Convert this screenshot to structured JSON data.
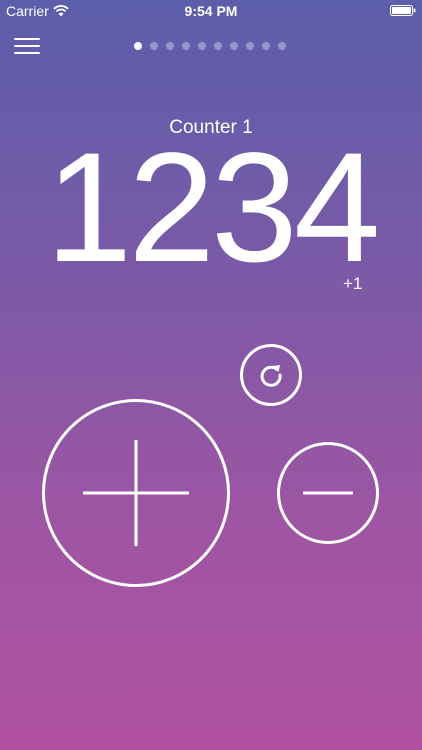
{
  "status_bar": {
    "carrier": "Carrier",
    "time": "9:54 PM"
  },
  "pager": {
    "total_pages": 10,
    "active_index": 0
  },
  "counter": {
    "name": "Counter 1",
    "value": "1234",
    "step_label": "+1"
  },
  "icons": {
    "menu": "hamburger-menu-icon",
    "reset": "reset-arrow-icon",
    "increment": "plus-icon",
    "decrement": "minus-icon"
  },
  "colors": {
    "gradient_top": "#5c5eab",
    "gradient_bottom": "#b152a0",
    "foreground": "#ffffff"
  }
}
